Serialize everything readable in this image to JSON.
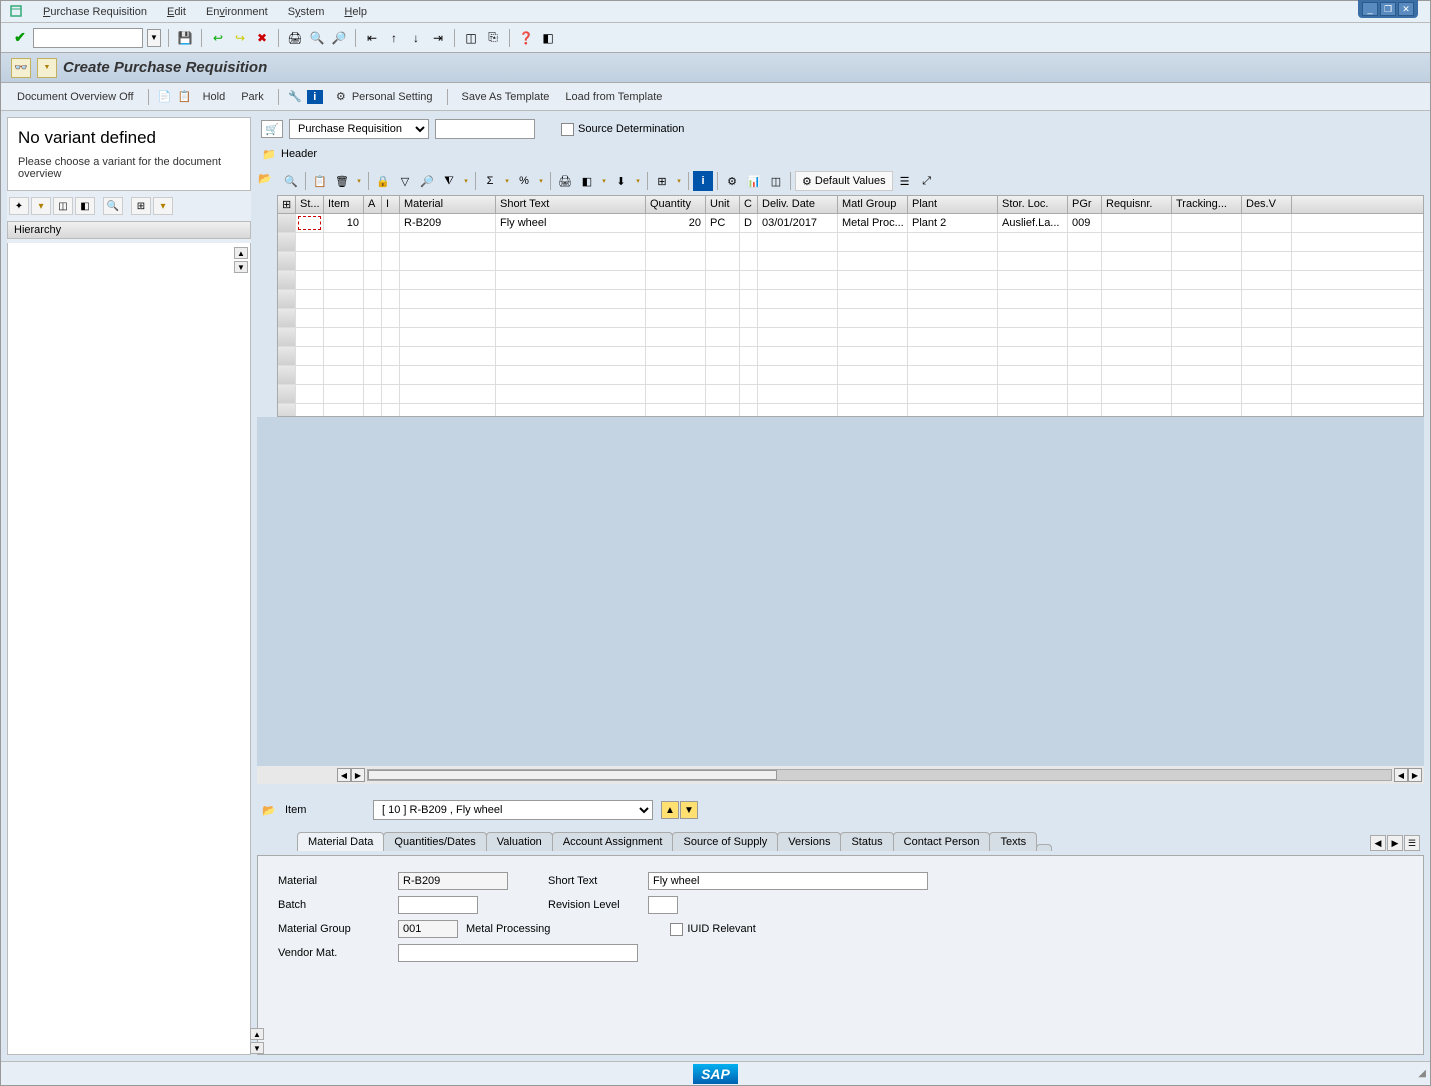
{
  "menubar": {
    "items": [
      "Purchase Requisition",
      "Edit",
      "Environment",
      "System",
      "Help"
    ]
  },
  "title": "Create Purchase Requisition",
  "apptoolbar": {
    "doc_overview": "Document Overview Off",
    "hold": "Hold",
    "park": "Park",
    "personal_setting": "Personal Setting",
    "save_template": "Save As Template",
    "load_template": "Load from Template"
  },
  "left": {
    "heading": "No variant defined",
    "text": "Please choose a variant for the document overview",
    "hierarchy_label": "Hierarchy"
  },
  "doc": {
    "type_label": "Purchase Requisition",
    "number": "",
    "source_det": "Source Determination",
    "header_label": "Header"
  },
  "grid_toolbar": {
    "default_values": "Default Values"
  },
  "grid": {
    "columns": [
      "St...",
      "Item",
      "A",
      "I",
      "Material",
      "Short Text",
      "Quantity",
      "Unit",
      "C",
      "Deliv. Date",
      "Matl Group",
      "Plant",
      "Stor. Loc.",
      "PGr",
      "Requisnr.",
      "Tracking...",
      "Des.V"
    ],
    "rows": [
      {
        "item": "10",
        "a": "",
        "i": "",
        "material": "R-B209",
        "short_text": "Fly wheel",
        "quantity": "20",
        "unit": "PC",
        "c": "D",
        "deliv_date": "03/01/2017",
        "matl_group": "Metal Proc...",
        "plant": "Plant 2",
        "stor_loc": "Auslief.La...",
        "pgr": "009",
        "requisnr": "",
        "tracking": "",
        "desv": ""
      }
    ]
  },
  "item_detail": {
    "label": "Item",
    "selected": "[ 10 ] R-B209 , Fly wheel",
    "tabs": [
      "Material Data",
      "Quantities/Dates",
      "Valuation",
      "Account Assignment",
      "Source of Supply",
      "Versions",
      "Status",
      "Contact Person",
      "Texts"
    ],
    "material_label": "Material",
    "material": "R-B209",
    "short_text_label": "Short Text",
    "short_text": "Fly wheel",
    "batch_label": "Batch",
    "batch": "",
    "revision_label": "Revision Level",
    "revision": "",
    "matgroup_label": "Material Group",
    "matgroup": "001",
    "matgroup_text": "Metal Processing",
    "iuid_label": "IUID Relevant",
    "vendor_mat_label": "Vendor Mat.",
    "vendor_mat": ""
  },
  "statusbar": {
    "logo": "SAP"
  }
}
